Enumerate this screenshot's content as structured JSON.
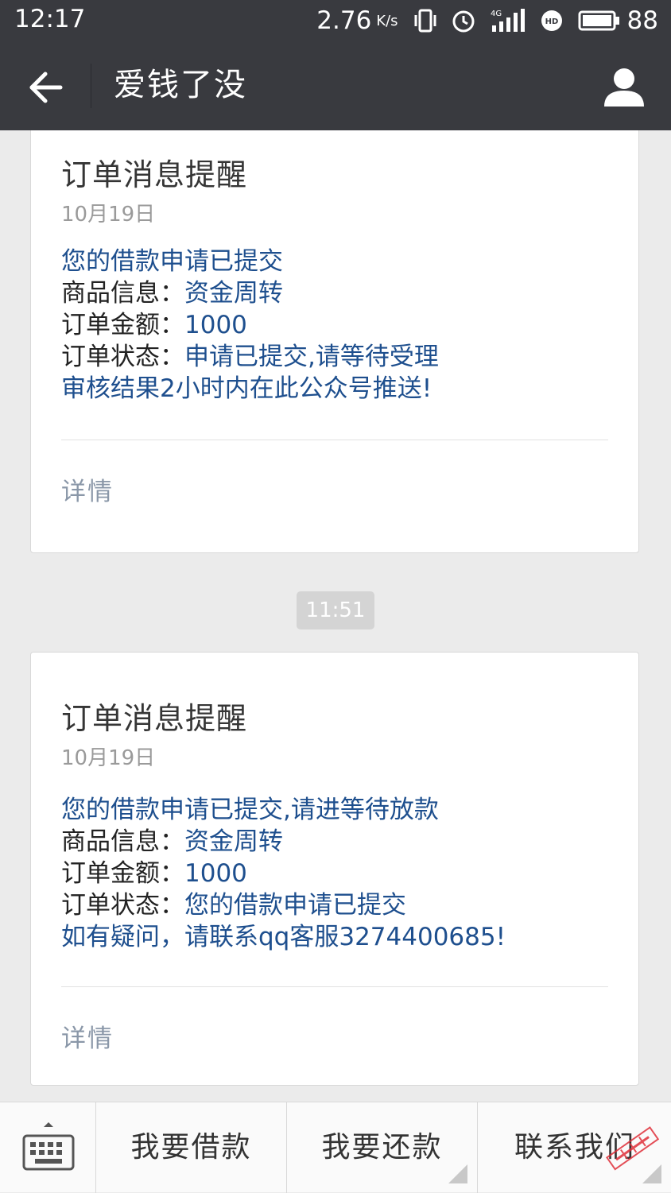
{
  "status_bar": {
    "time": "12:17",
    "speed": "2.76",
    "speed_unit": "K/s",
    "network": "4G",
    "battery": "88"
  },
  "header": {
    "title": "爱钱了没"
  },
  "messages": [
    {
      "title": "订单消息提醒",
      "date": "10月19日",
      "lines": [
        {
          "label": "",
          "value": "您的借款申请已提交"
        },
        {
          "label": "商品信息：",
          "value": "资金周转"
        },
        {
          "label": "订单金额：",
          "value": "1000"
        },
        {
          "label": "订单状态：",
          "value": "申请已提交,请等待受理"
        },
        {
          "label": "",
          "value": "审核结果2小时内在此公众号推送!"
        }
      ],
      "details_label": "详情"
    },
    {
      "title": "订单消息提醒",
      "date": "10月19日",
      "lines": [
        {
          "label": "",
          "value": "您的借款申请已提交,请进等待放款"
        },
        {
          "label": "商品信息：",
          "value": "资金周转"
        },
        {
          "label": "订单金额：",
          "value": "1000"
        },
        {
          "label": "订单状态：",
          "value": "您的借款申请已提交"
        },
        {
          "label": "",
          "value": "如有疑问，请联系qq客服3274400685!"
        }
      ],
      "details_label": "详情"
    }
  ],
  "timestamp": "11:51",
  "menu": {
    "items": [
      "我要借款",
      "我要还款",
      "联系我们"
    ]
  },
  "colors": {
    "header_bg": "#393a3f",
    "chat_bg": "#ebebeb",
    "message_blue": "#1e4f8e",
    "details_gray": "#8a97a8"
  }
}
